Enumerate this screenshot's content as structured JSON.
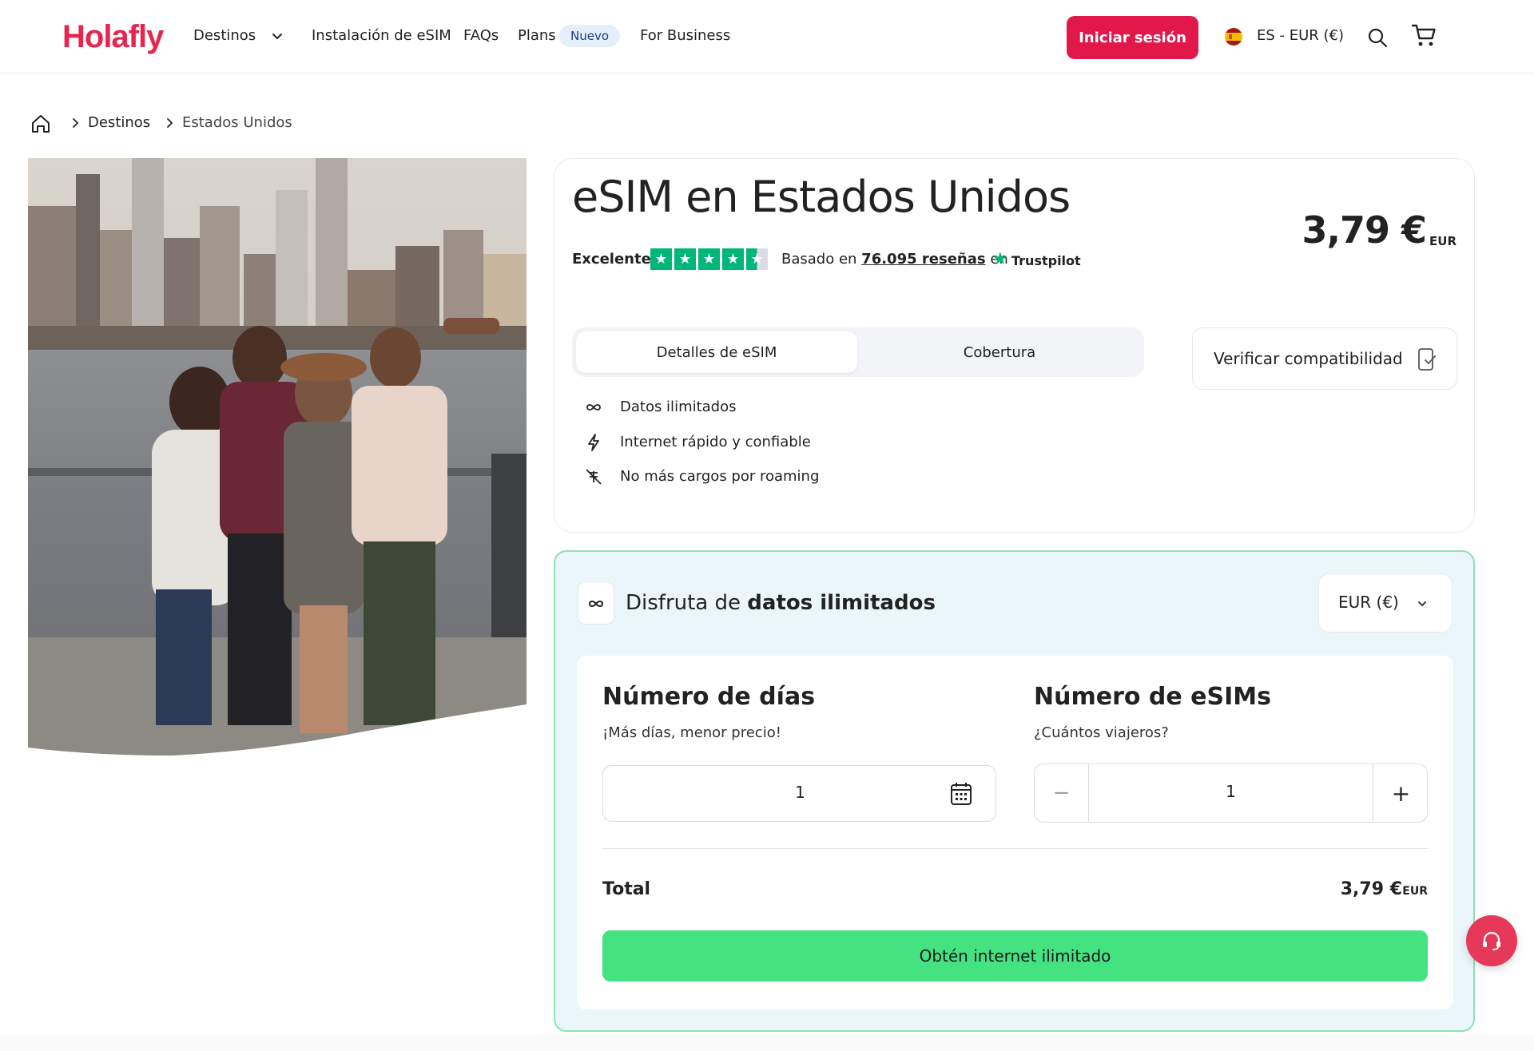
{
  "brand": {
    "logo": "Holafly",
    "accent": "#e2174a",
    "cta_color": "#45e282",
    "panel_border": "#8fe2b4",
    "trustpilot_green": "#00b67a"
  },
  "nav": {
    "destinos": "Destinos",
    "instalacion": "Instalación de eSIM",
    "faqs": "FAQs",
    "plans": "Plans",
    "plans_badge": "Nuevo",
    "business": "For Business",
    "login": "Iniciar sesión",
    "locale": "ES - EUR (€)",
    "icons": [
      "chevron-down-icon",
      "spain-flag-icon",
      "search-icon",
      "cart-icon"
    ]
  },
  "breadcrumb": {
    "items": [
      "Destinos",
      "Estados Unidos"
    ],
    "icons": [
      "home-icon",
      "chevron-right-icon"
    ]
  },
  "product": {
    "title": "eSIM en Estados Unidos",
    "price": "3,79 €",
    "price_unit": "EUR",
    "rating_label": "Excelente",
    "rating_stars": 4.5,
    "reviews_prefix": "Basado en",
    "reviews_count": "76.095 reseñas",
    "reviews_suffix": "en",
    "reviews_source": "Trustpilot",
    "tabs": [
      "Detalles de eSIM",
      "Cobertura"
    ],
    "active_tab": "Detalles de eSIM",
    "compat_button": "Verificar compatibilidad",
    "features": [
      {
        "icon": "infinity-icon",
        "text": "Datos ilimitados"
      },
      {
        "icon": "lightning-icon",
        "text": "Internet rápido y confiable"
      },
      {
        "icon": "no-roaming-icon",
        "text": "No más cargos por roaming"
      }
    ]
  },
  "panel": {
    "title_prefix": "Disfruta de",
    "title_bold": "datos ilimitados",
    "currency": "EUR (€)",
    "days": {
      "title": "Número de días",
      "subtitle": "¡Más días, menor precio!",
      "value": "1"
    },
    "esims": {
      "title": "Número de eSIMs",
      "subtitle": "¿Cuántos viajeros?",
      "value": "1",
      "minus": "−",
      "plus": "+"
    },
    "total_label": "Total",
    "total_value": "3,79 €",
    "total_unit": "EUR",
    "cta": "Obtén internet ilimitado"
  }
}
